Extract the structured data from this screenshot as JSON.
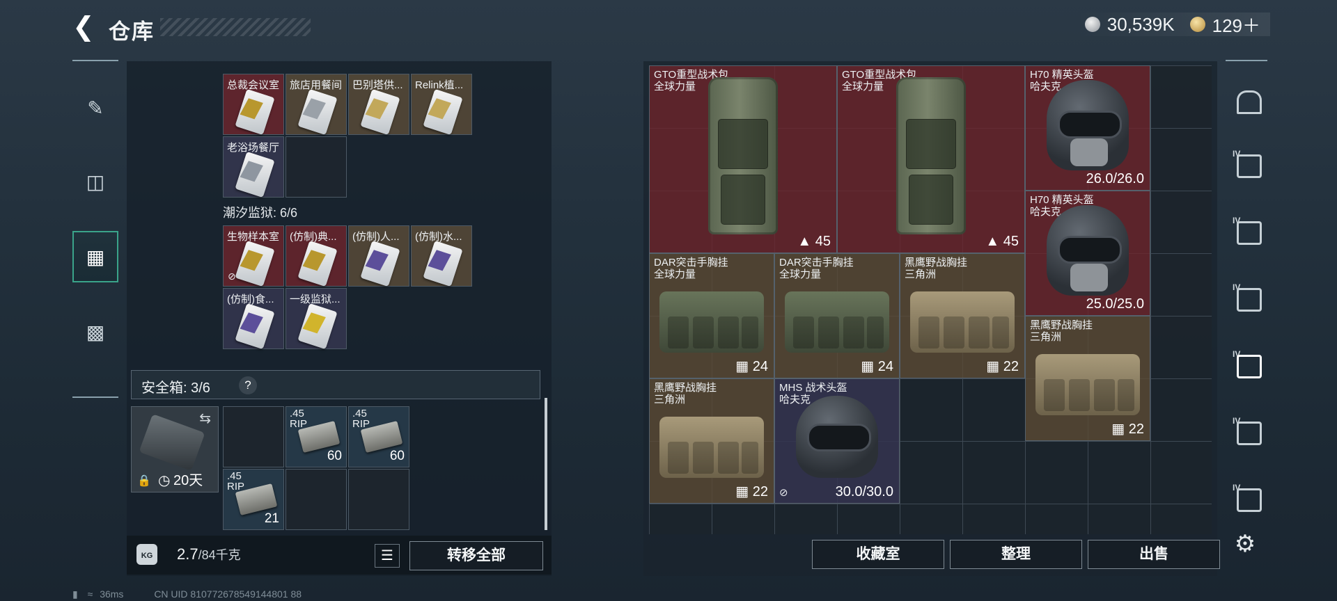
{
  "header": {
    "back_icon": "chevron-left-icon",
    "title": "仓库",
    "currency": [
      {
        "icon": "silver-coin-icon",
        "value": "30,539K",
        "color": "#c9ced4"
      },
      {
        "icon": "gold-coin-icon",
        "value": "129＋",
        "color": "#d4aa5c"
      }
    ]
  },
  "left_nav": [
    {
      "icon": "gun-icon",
      "active": false
    },
    {
      "icon": "armor-icon",
      "active": false
    },
    {
      "icon": "backpack-icon",
      "active": true
    },
    {
      "icon": "toolbox-icon",
      "active": false
    }
  ],
  "collection": {
    "row1": [
      "总裁会议室",
      "旅店用餐间",
      "巴别塔供...",
      "Relink植..."
    ],
    "row2": [
      "老浴场餐厅"
    ],
    "section2_title": "潮汐监狱: 6/6",
    "row3": [
      "生物样本室",
      "(仿制)典...",
      "(仿制)人...",
      "(仿制)水..."
    ],
    "row4": [
      "(仿制)食...",
      "一级监狱..."
    ]
  },
  "safe": {
    "label": "安全箱: 3/6",
    "help": "?",
    "timer": "20天",
    "ammo": [
      {
        "label": ".45\nRIP",
        "count": "60"
      },
      {
        "label": ".45\nRIP",
        "count": "60"
      },
      {
        "label": ".45\nRIP",
        "count": "21"
      }
    ]
  },
  "weight": {
    "kg_icon": "KG",
    "current": "2.7",
    "max": "/84千克",
    "transfer_all": "转移全部"
  },
  "status": {
    "ping": "36ms",
    "uid": "CN UID 810772678549144801 88"
  },
  "inventory": [
    {
      "name": "GTO重型战术包",
      "sub": "全球力量",
      "cap": "45",
      "color": "red"
    },
    {
      "name": "GTO重型战术包",
      "sub": "全球力量",
      "cap": "45",
      "color": "red"
    },
    {
      "name": "H70 精英头盔",
      "sub": "哈夫克",
      "dur": "26.0/26.0",
      "color": "red"
    },
    {
      "name": "H70 精英头盔",
      "sub": "哈夫克",
      "dur": "25.0/25.0",
      "color": "red"
    },
    {
      "name": "DAR突击手胸挂",
      "sub": "全球力量",
      "cap": "24",
      "color": "gold"
    },
    {
      "name": "DAR突击手胸挂",
      "sub": "全球力量",
      "cap": "24",
      "color": "gold"
    },
    {
      "name": "黑鹰野战胸挂",
      "sub": "三角洲",
      "cap": "22",
      "color": "gold"
    },
    {
      "name": "黑鹰野战胸挂",
      "sub": "三角洲",
      "cap": "22",
      "color": "gold"
    },
    {
      "name": "黑鹰野战胸挂",
      "sub": "三角洲",
      "cap": "22",
      "color": "gold"
    },
    {
      "name": "MHS 战术头盔",
      "sub": "哈夫克",
      "dur": "30.0/30.0",
      "color": "purple"
    }
  ],
  "actions": {
    "collection_room": "收藏室",
    "organize": "整理",
    "sell": "出售"
  },
  "right_sidebar": [
    {
      "icon": "home-icon",
      "tier": ""
    },
    {
      "icon": "folder-icon",
      "tier": "IV"
    },
    {
      "icon": "gun-case-icon",
      "tier": "IV"
    },
    {
      "icon": "triangle-box-icon",
      "tier": "IV"
    },
    {
      "icon": "triangle-box-icon",
      "tier": "IV"
    },
    {
      "icon": "medkit-icon",
      "tier": "IV"
    },
    {
      "icon": "ammo-box-icon",
      "tier": "IV"
    }
  ],
  "settings_icon": "gear-icon"
}
